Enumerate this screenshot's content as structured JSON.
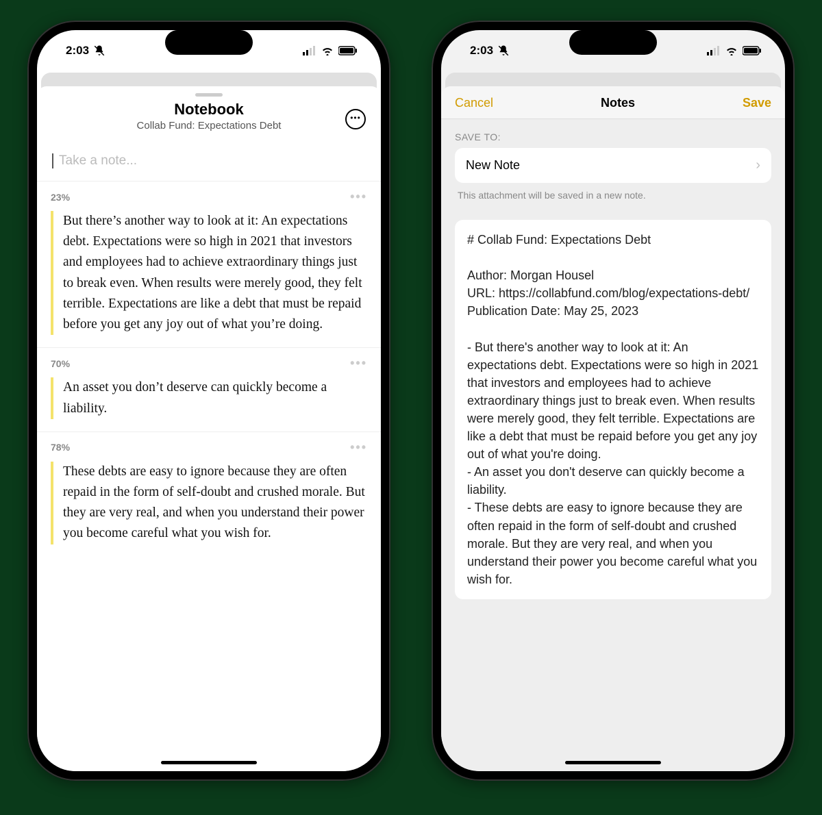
{
  "status": {
    "time": "2:03",
    "mute_icon": "bell-slash-icon",
    "signal_icon": "cellular-signal-icon",
    "wifi_icon": "wifi-icon",
    "battery_icon": "battery-icon"
  },
  "notebook": {
    "title": "Notebook",
    "subtitle": "Collab Fund: Expectations Debt",
    "take_note_placeholder": "Take a note...",
    "more_icon": "ellipsis-circle-icon",
    "highlights": [
      {
        "percent": "23%",
        "text": "But there’s another way to look at it: An expectations debt. Expectations were so high in 2021 that investors and employees had to achieve extraordinary things just to break even. When results were merely good, they felt terrible. Expectations are like a debt that must be repaid before you get any joy out of what you’re doing."
      },
      {
        "percent": "70%",
        "text": "An asset you don’t deserve can quickly become a liability."
      },
      {
        "percent": "78%",
        "text": "These debts are easy to ignore because they are often repaid in the form of self-doubt and crushed morale. But they are very real, and when you understand their power you become careful what you wish for."
      }
    ]
  },
  "notes": {
    "cancel": "Cancel",
    "title": "Notes",
    "save": "Save",
    "save_to_label": "SAVE TO:",
    "destination": "New Note",
    "hint": "This attachment will be saved in a new note.",
    "body": "# Collab Fund: Expectations Debt\n\nAuthor: Morgan Housel\nURL: https://collabfund.com/blog/expectations-debt/\nPublication Date: May 25, 2023\n\n- But there's another way to look at it: An expectations debt. Expectations were so high in 2021 that investors and employees had to achieve extraordinary things just to break even. When results were merely good, they felt terrible. Expectations are like a debt that must be repaid before you get any joy out of what you're doing.\n- An asset you don't deserve can quickly become a liability.\n- These debts are easy to ignore because they are often repaid in the form of self-doubt and crushed morale. But they are very real, and when you understand their power you become careful what you wish for."
  }
}
